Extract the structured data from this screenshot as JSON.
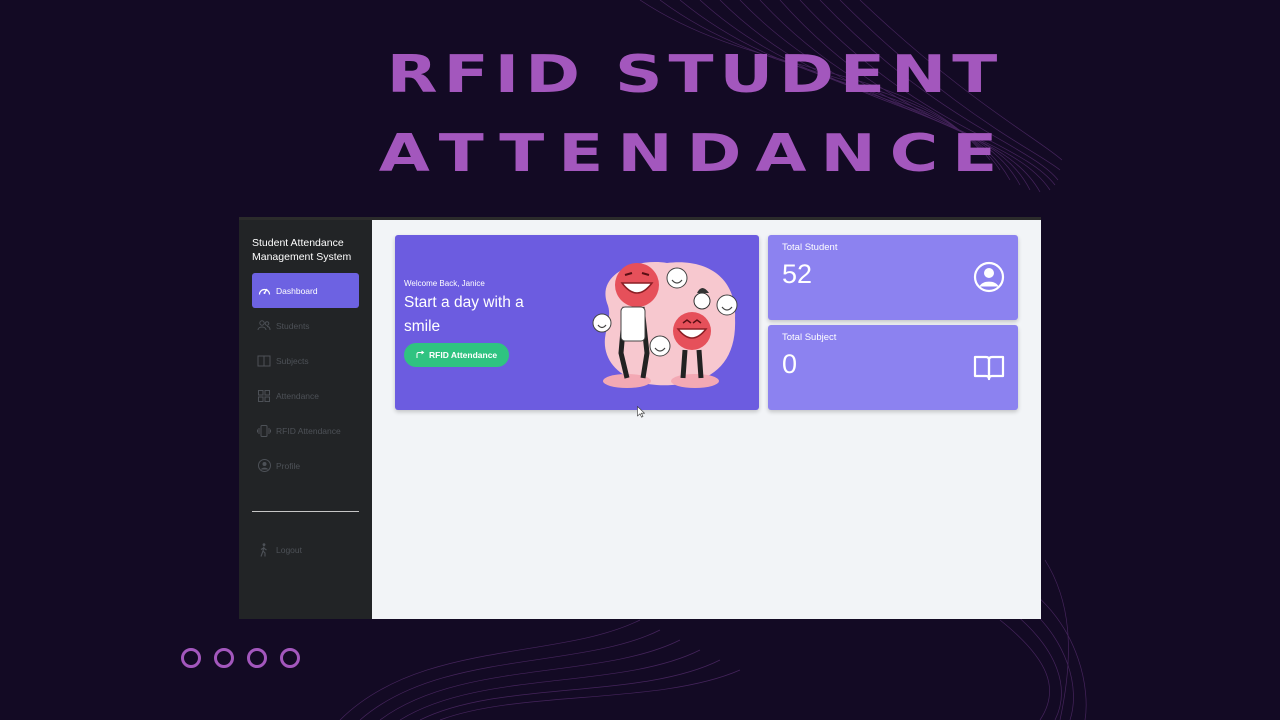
{
  "headline": {
    "line1": "RFID STUDENT",
    "line2": "ATTENDANCE"
  },
  "sidebar": {
    "brand": "Student Attendance Management System",
    "items": [
      {
        "label": "Dashboard",
        "icon": "speedometer-icon",
        "active": true
      },
      {
        "label": "Students",
        "icon": "users-icon",
        "active": false
      },
      {
        "label": "Subjects",
        "icon": "book-icon",
        "active": false
      },
      {
        "label": "Attendance",
        "icon": "grid-icon",
        "active": false
      },
      {
        "label": "RFID Attendance",
        "icon": "phone-vibrate-icon",
        "active": false
      },
      {
        "label": "Profile",
        "icon": "user-circle-icon",
        "active": false
      }
    ],
    "logout": {
      "label": "Logout",
      "icon": "walking-person-icon"
    }
  },
  "welcome": {
    "greeting": "Welcome Back, Janice",
    "headline": "Start a day with a smile",
    "cta_label": "RFID Attendance",
    "cta_icon": "arrow-share-icon"
  },
  "stats": [
    {
      "label": "Total Student",
      "value": "52",
      "icon": "user-circle-icon"
    },
    {
      "label": "Total Subject",
      "value": "0",
      "icon": "open-book-icon"
    }
  ],
  "colors": {
    "background": "#130a24",
    "headline": "#a357bd",
    "sidebar": "#222426",
    "accent": "#6d62e2",
    "welcome_card": "#6c5ce0",
    "stat_card": "#8c82f0",
    "cta": "#2fc381",
    "content_bg": "#f2f4f7"
  }
}
